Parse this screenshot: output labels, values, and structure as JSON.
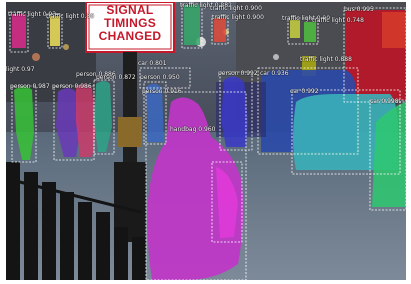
{
  "sign": {
    "line1": "SIGNAL",
    "line2": "TIMINGS",
    "line3": "CHANGED"
  },
  "detections": [
    {
      "text": "traffic light 0.93",
      "color": "#dd2a8b"
    },
    {
      "text": "traffic light 0.80",
      "color": "#f0e05a"
    },
    {
      "text": "traffic light 0.882",
      "color": "#35a86a"
    },
    {
      "text": "traffic light 0.900",
      "color": "#a52aa8"
    },
    {
      "text": "traffic light 0.900",
      "color": "#e04a3a"
    },
    {
      "text": "traffic light 0.90",
      "color": "#50c040"
    },
    {
      "text": "traffic light 0.748",
      "color": "#c8d040"
    },
    {
      "text": "bus 0.995",
      "color": "#d02040"
    },
    {
      "text": "traffic light 0.888",
      "color": "#c0c000"
    },
    {
      "text": "light 0.97",
      "color": "#c89060"
    },
    {
      "text": "person 0.987",
      "color": "#36c236"
    },
    {
      "text": "person 0.986",
      "color": "#6a3ab8"
    },
    {
      "text": "person 0.886",
      "color": "#d23a6a"
    },
    {
      "text": "person 0.872",
      "color": "#2aa888"
    },
    {
      "text": "car 0.801",
      "color": "#8a8aa8"
    },
    {
      "text": "person 0.950",
      "color": "#3a4ab8"
    },
    {
      "text": "person 0.916",
      "color": "#3a6ac8"
    },
    {
      "text": "person 0.992",
      "color": "#3a3ac8"
    },
    {
      "text": "car 0.936",
      "color": "#2a3aa8"
    },
    {
      "text": "car 0.992",
      "color": "#2a6ad8"
    },
    {
      "text": "car 0.998",
      "color": "#3ac8c8"
    },
    {
      "text": "handbag 0.960",
      "color": "#a82aa8"
    }
  ]
}
